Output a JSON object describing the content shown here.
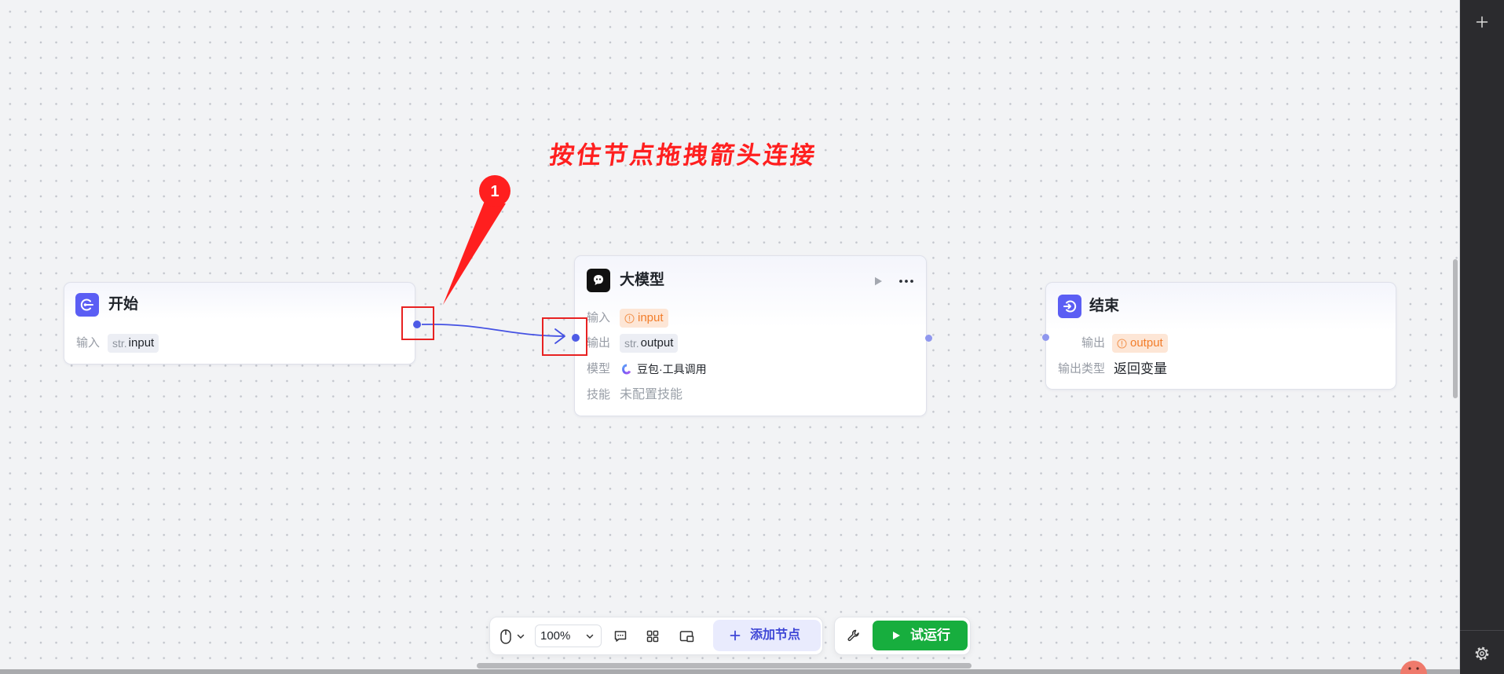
{
  "annotation": {
    "instruction_text": "按住节点拖拽箭头连接",
    "callout_number": "1"
  },
  "nodes": {
    "start": {
      "icon": "start-icon",
      "title": "开始",
      "input_label": "输入",
      "input_type": "str.",
      "input_value": "input"
    },
    "llm": {
      "icon": "llm-icon",
      "title": "大模型",
      "input_label": "输入",
      "input_value": "input",
      "output_label": "输出",
      "output_type": "str.",
      "output_value": "output",
      "model_label": "模型",
      "model_icon": "doubao-model-icon",
      "model_value": "豆包·工具调用",
      "skill_label": "技能",
      "skill_value": "未配置技能"
    },
    "end": {
      "icon": "end-icon",
      "title": "结束",
      "output_label": "输出",
      "output_value": "output",
      "output_type_label": "输出类型",
      "output_type_value": "返回变量"
    }
  },
  "toolbar": {
    "zoom": "100%",
    "add_node_label": "添加节点",
    "test_run_label": "试运行"
  },
  "colors": {
    "accent": "#5b5ef4",
    "edge": "#4451e3",
    "warn": "#f27d2a",
    "run": "#17ae3e",
    "mark": "#ff1f1f"
  }
}
